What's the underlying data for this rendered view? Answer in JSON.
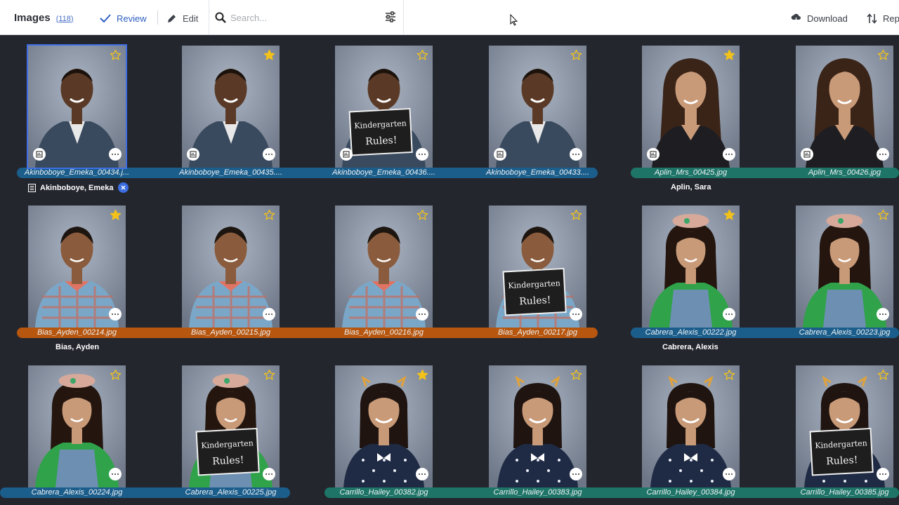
{
  "toolbar": {
    "title": "Images",
    "count": "(118)",
    "review_label": "Review",
    "edit_label": "Edit",
    "search_placeholder": "Search...",
    "download_label": "Download",
    "report_label": "Rep"
  },
  "colors": {
    "accent": "#2f5fc4",
    "band_blue": "#1b5e8c",
    "band_orange": "#b7560e",
    "band_teal": "#1d7467",
    "star_yellow": "#f2c21a",
    "background": "#24262e"
  },
  "groups": {
    "akinboboye": "Akinboboye, Emeka",
    "aplin": "Aplin, Sara",
    "bias": "Bias, Ayden",
    "cabrera": "Cabrera, Alexis"
  },
  "images": [
    {
      "file": "Akinboboye_Emeka_00434.j...",
      "starred": false,
      "selected": true
    },
    {
      "file": "Akinboboye_Emeka_00435....",
      "starred": true
    },
    {
      "file": "Akinboboye_Emeka_00436....",
      "starred": false,
      "sign": true
    },
    {
      "file": "Akinboboye_Emeka_00433....",
      "starred": false
    },
    {
      "file": "Aplin_Mrs_00425.jpg",
      "starred": true
    },
    {
      "file": "Aplin_Mrs_00426.jpg",
      "starred": false
    },
    {
      "file": "Bias_Ayden_00214.jpg",
      "starred": true
    },
    {
      "file": "Bias_Ayden_00215.jpg",
      "starred": false
    },
    {
      "file": "Bias_Ayden_00216.jpg",
      "starred": false
    },
    {
      "file": "Bias_Ayden_00217.jpg",
      "starred": false,
      "sign": true
    },
    {
      "file": "Cabrera_Alexis_00222.jpg",
      "starred": true
    },
    {
      "file": "Cabrera_Alexis_00223.jpg",
      "starred": false
    },
    {
      "file": "Cabrera_Alexis_00224.jpg",
      "starred": false
    },
    {
      "file": "Cabrera_Alexis_00225.jpg",
      "starred": false,
      "sign": true
    },
    {
      "file": "Carrillo_Hailey_00382.jpg",
      "starred": true
    },
    {
      "file": "Carrillo_Hailey_00383.jpg",
      "starred": false
    },
    {
      "file": "Carrillo_Hailey_00384.jpg",
      "starred": false
    },
    {
      "file": "Carrillo_Hailey_00385.jpg",
      "starred": false,
      "sign": true
    }
  ],
  "sign_text": [
    "Kindergarten",
    "Rules!"
  ]
}
